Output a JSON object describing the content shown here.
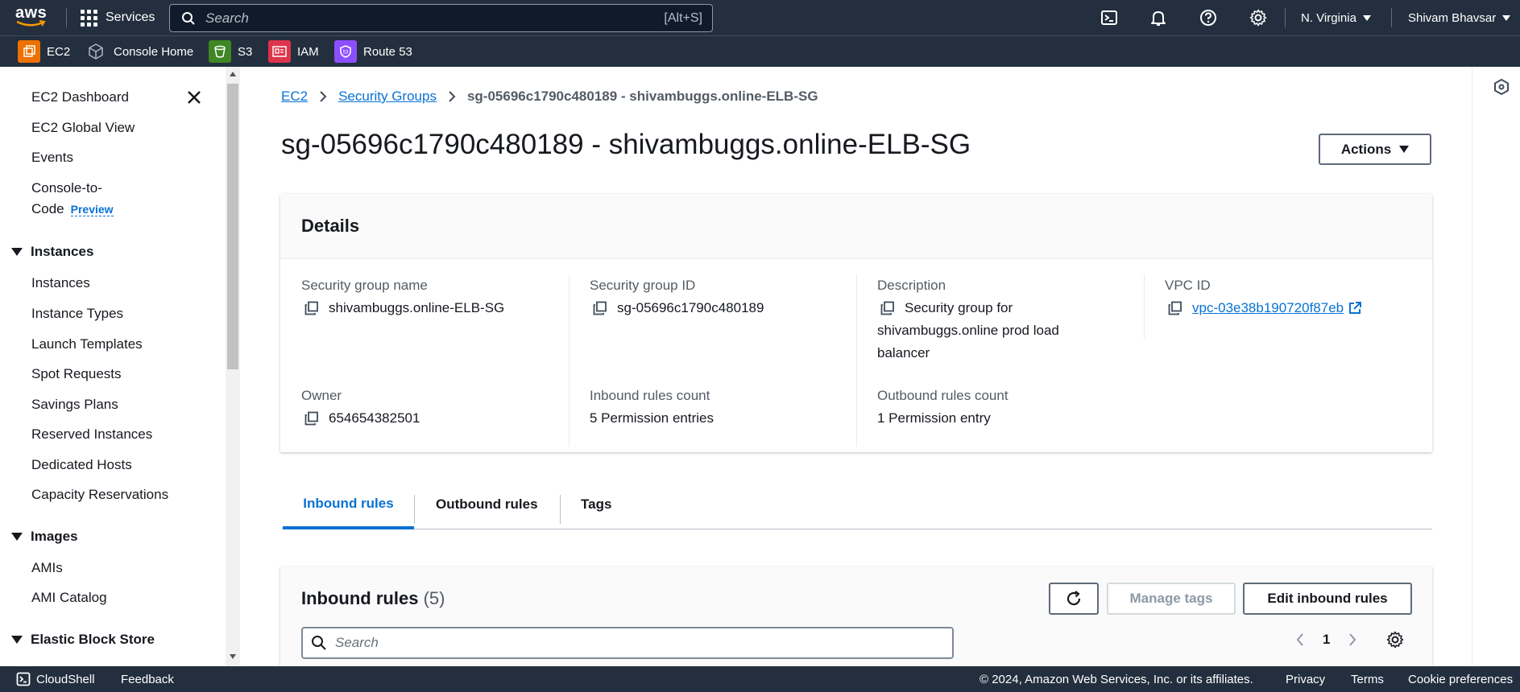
{
  "topnav": {
    "logo": "aws",
    "services_label": "Services",
    "search_placeholder": "Search",
    "search_shortcut": "[Alt+S]",
    "region": "N. Virginia",
    "user": "Shivam Bhavsar"
  },
  "favorites": [
    {
      "label": "EC2",
      "color": "#ed7100"
    },
    {
      "label": "Console Home",
      "color": "#232f3e"
    },
    {
      "label": "S3",
      "color": "#3f8624"
    },
    {
      "label": "IAM",
      "color": "#dd344c"
    },
    {
      "label": "Route 53",
      "color": "#8c4fff"
    }
  ],
  "sidebar": {
    "top_items": [
      "EC2 Dashboard",
      "EC2 Global View",
      "Events"
    ],
    "console_to_code": "Console-to-",
    "console_to_code_2": "Code",
    "preview": "Preview",
    "instances_head": "Instances",
    "instances_items": [
      "Instances",
      "Instance Types",
      "Launch Templates",
      "Spot Requests",
      "Savings Plans",
      "Reserved Instances",
      "Dedicated Hosts",
      "Capacity Reservations"
    ],
    "images_head": "Images",
    "images_items": [
      "AMIs",
      "AMI Catalog"
    ],
    "ebs_head": "Elastic Block Store"
  },
  "breadcrumb": {
    "ec2": "EC2",
    "security_groups": "Security Groups",
    "current": "sg-05696c1790c480189 - shivambuggs.online-ELB-SG"
  },
  "page": {
    "title": "sg-05696c1790c480189 - shivambuggs.online-ELB-SG",
    "actions_label": "Actions"
  },
  "details": {
    "title": "Details",
    "sg_name_label": "Security group name",
    "sg_name": "shivambuggs.online-ELB-SG",
    "sg_id_label": "Security group ID",
    "sg_id": "sg-05696c1790c480189",
    "description_label": "Description",
    "description_1": "Security group for",
    "description_2": "shivambuggs.online prod load",
    "description_3": "balancer",
    "vpc_label": "VPC ID",
    "vpc_id": "vpc-03e38b190720f87eb",
    "owner_label": "Owner",
    "owner": "654654382501",
    "inbound_count_label": "Inbound rules count",
    "inbound_count": "5 Permission entries",
    "outbound_count_label": "Outbound rules count",
    "outbound_count": "1 Permission entry"
  },
  "tabs": {
    "inbound": "Inbound rules",
    "outbound": "Outbound rules",
    "tags": "Tags"
  },
  "inbound_panel": {
    "title": "Inbound rules",
    "count": "(5)",
    "manage_tags": "Manage tags",
    "edit": "Edit inbound rules",
    "search_placeholder": "Search",
    "page": "1"
  },
  "footer": {
    "cloudshell": "CloudShell",
    "feedback": "Feedback",
    "copyright": "© 2024, Amazon Web Services, Inc. or its affiliates.",
    "privacy": "Privacy",
    "terms": "Terms",
    "cookies": "Cookie preferences"
  }
}
